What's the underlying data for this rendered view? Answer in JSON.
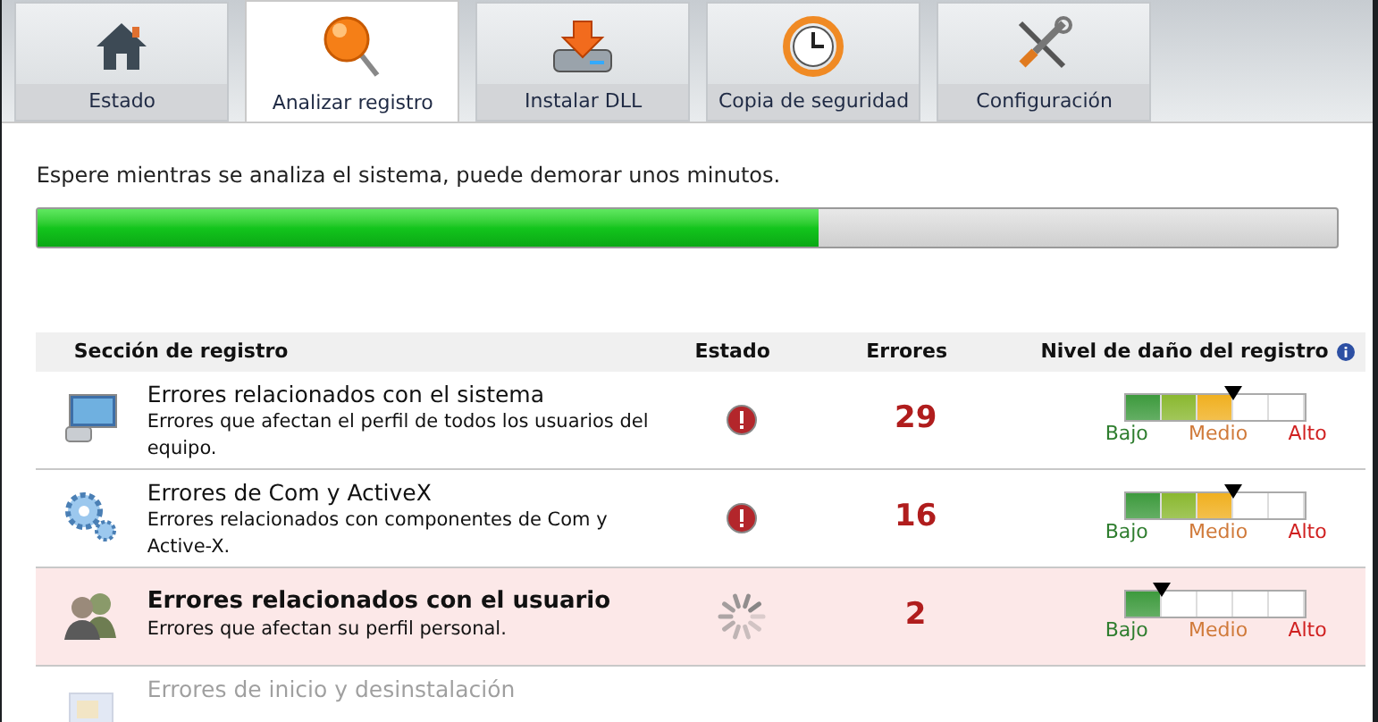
{
  "tabs": [
    {
      "label": "Estado",
      "selected": false
    },
    {
      "label": "Analizar registro",
      "selected": true
    },
    {
      "label": "Instalar DLL",
      "selected": false
    },
    {
      "label": "Copia de seguridad",
      "selected": false
    },
    {
      "label": "Configuración",
      "selected": false
    }
  ],
  "message": "Espere mientras se analiza el sistema, puede demorar unos minutos.",
  "progress": {
    "level": 0.6
  },
  "table": {
    "columns": [
      "Sección de registro",
      "Estado",
      "Errores",
      "Nivel de daño del registro"
    ],
    "rows": [
      {
        "title": "Errores relacionados con el sistema",
        "description": "Errores que afectan el perfil de todos los usuarios del equipo.",
        "kind": "error",
        "errors": "29",
        "level": 0.6,
        "scale_labels": [
          "Bajo",
          "Medio",
          "Alto"
        ],
        "active": false,
        "disabled": false
      },
      {
        "title": "Errores de Com y ActiveX",
        "description": "Errores relacionados con componentes de Com y Active-X.",
        "kind": "error",
        "errors": "16",
        "level": 0.6,
        "scale_labels": [
          "Bajo",
          "Medio",
          "Alto"
        ],
        "active": false,
        "disabled": false
      },
      {
        "title": "Errores relacionados con el usuario",
        "description": "Errores que afectan su perfil personal.",
        "kind": "scanning",
        "errors": "2",
        "level": 0.2,
        "scale_labels": [
          "Bajo",
          "Medio",
          "Alto"
        ],
        "active": true,
        "disabled": false
      },
      {
        "title": "Errores de inicio y desinstalación",
        "kind": "pending",
        "active": false,
        "disabled": true
      }
    ]
  }
}
